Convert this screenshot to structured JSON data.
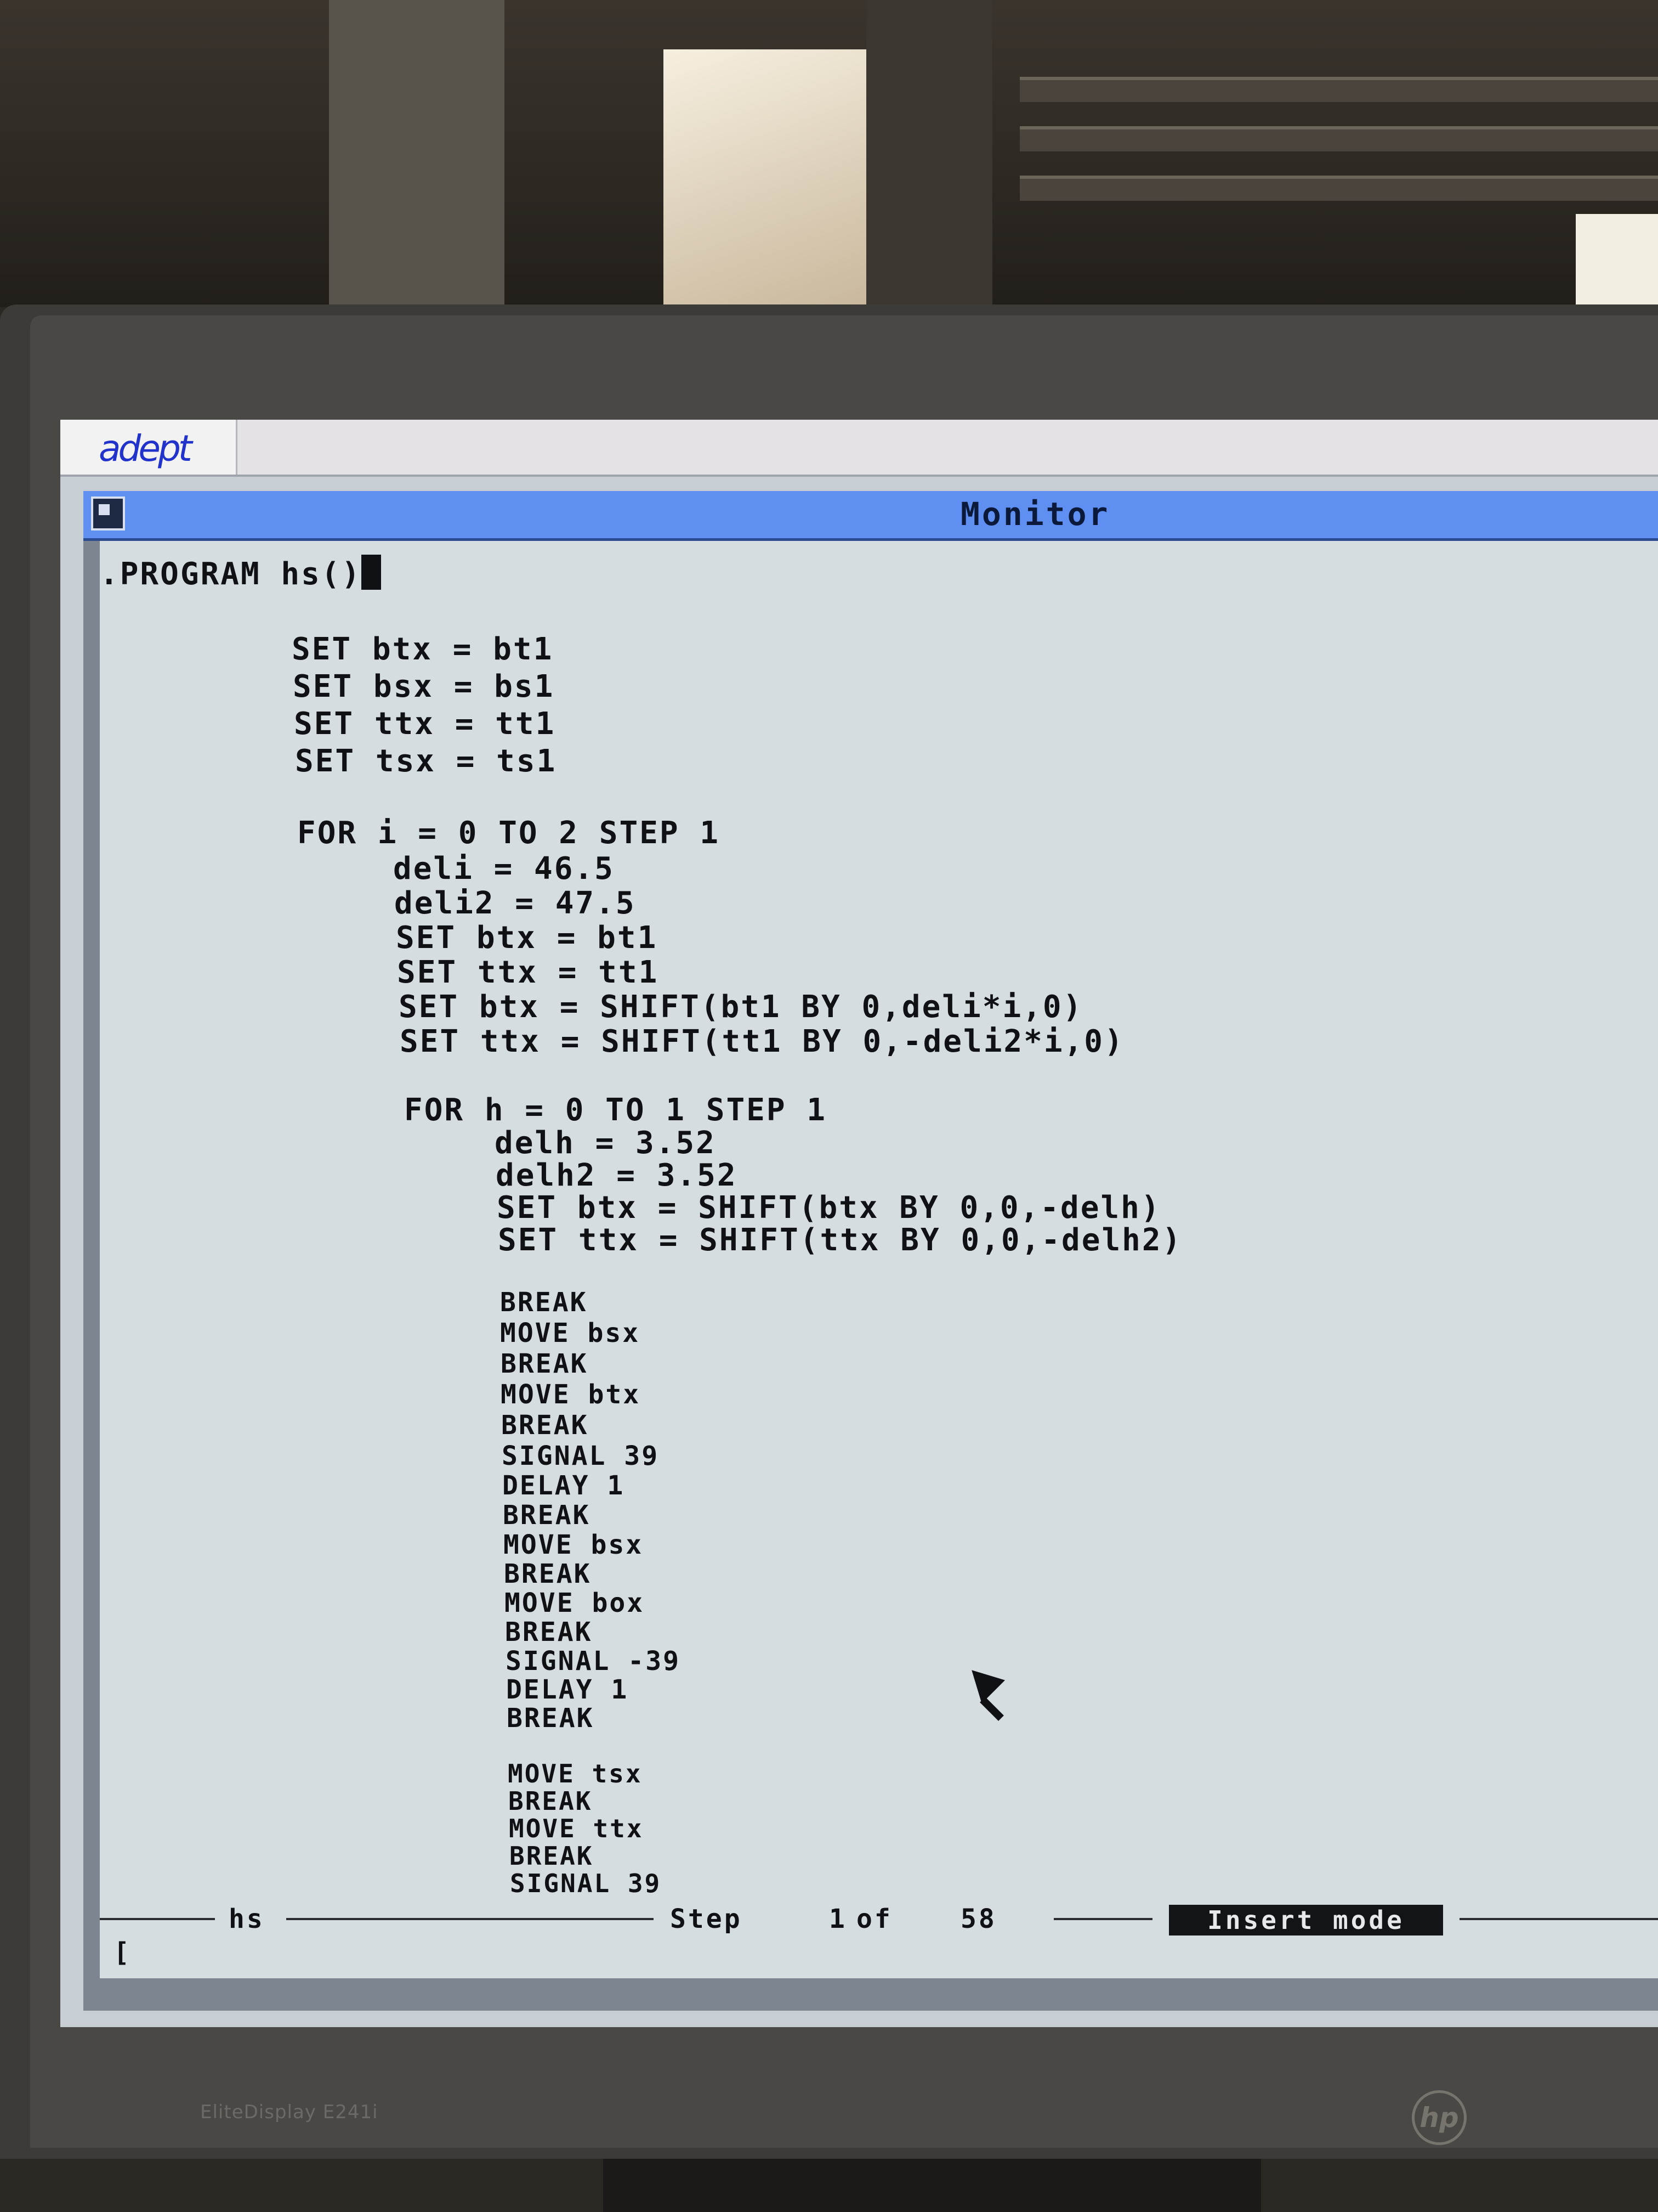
{
  "brand": {
    "app_logo": "adept",
    "monitor_model": "EliteDisplay E241i",
    "monitor_logo": "hp"
  },
  "window": {
    "title": "Monitor"
  },
  "code": {
    "lines": [
      ".PROGRAM hs()",
      "SET btx = bt1",
      "SET bsx = bs1",
      "SET ttx = tt1",
      "SET tsx = ts1",
      "FOR i = 0 TO 2 STEP 1",
      "deli = 46.5",
      "deli2 = 47.5",
      "SET btx = bt1",
      "SET ttx = tt1",
      "SET btx = SHIFT(bt1 BY 0,deli*i,0)",
      "SET ttx = SHIFT(tt1 BY 0,-deli2*i,0)",
      "FOR h = 0 TO 1 STEP 1",
      "delh = 3.52",
      "delh2 = 3.52",
      "SET btx = SHIFT(btx BY 0,0,-delh)",
      "SET ttx = SHIFT(ttx BY 0,0,-delh2)",
      "BREAK",
      "MOVE bsx",
      "BREAK",
      "MOVE btx",
      "BREAK",
      "SIGNAL 39",
      "DELAY 1",
      "BREAK",
      "MOVE bsx",
      "BREAK",
      "MOVE box",
      "BREAK",
      "SIGNAL -39",
      "DELAY 1",
      "BREAK",
      "MOVE tsx",
      "BREAK",
      "MOVE ttx",
      "BREAK",
      "SIGNAL 39"
    ]
  },
  "status": {
    "program": "hs",
    "step_label": "Step",
    "step_current": "1",
    "of_label": "of",
    "step_total": "58",
    "mode": "Insert mode",
    "command_prompt": "["
  }
}
